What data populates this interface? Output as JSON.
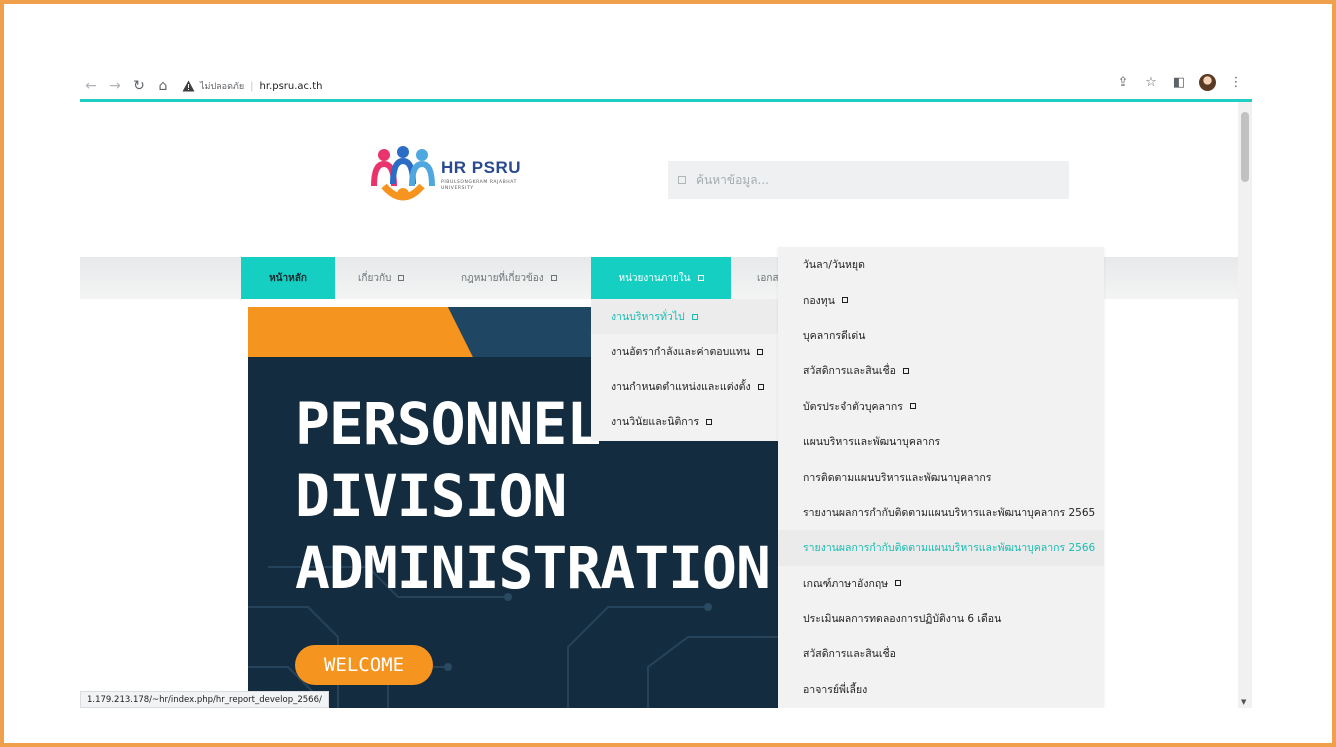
{
  "browser": {
    "security_label": "ไม่ปลอดภัย",
    "url": "hr.psru.ac.th",
    "status_url": "1.179.213.178/~hr/index.php/hr_report_develop_2566/"
  },
  "header": {
    "logo_title": "HR PSRU",
    "logo_subtitle": "PIBULSONGKRAM RAJABHAT UNIVERSITY",
    "search_placeholder": "ค้นหาข้อมูล..."
  },
  "menu": {
    "items": [
      {
        "label": "หน้าหลัก"
      },
      {
        "label": "เกี่ยวกับ"
      },
      {
        "label": "กฎหมายที่เกี่ยวข้อง"
      },
      {
        "label": "หน่วยงานภายใน"
      },
      {
        "label": "เอกส"
      }
    ]
  },
  "submenu": {
    "items": [
      {
        "label": "งานบริหารทั่วไป"
      },
      {
        "label": "งานอัตรากำลังและค่าตอบแทน"
      },
      {
        "label": "งานกำหนดตำแหน่งและแต่งตั้ง"
      },
      {
        "label": "งานวินัยและนิติการ"
      }
    ]
  },
  "subsubmenu": {
    "items": [
      {
        "label": "วันลา/วันหยุด"
      },
      {
        "label": "กองทุน"
      },
      {
        "label": "บุคลากรดีเด่น"
      },
      {
        "label": "สวัสดิการและสินเชื่อ"
      },
      {
        "label": "บัตรประจำตัวบุคลากร"
      },
      {
        "label": "แผนบริหารและพัฒนาบุคลากร"
      },
      {
        "label": "การติดตามแผนบริหารและพัฒนาบุคลากร"
      },
      {
        "label": "รายงานผลการกำกับติดตามแผนบริหารและพัฒนาบุคลากร 2565"
      },
      {
        "label": "รายงานผลการกำกับติดตามแผนบริหารและพัฒนาบุคลากร 2566"
      },
      {
        "label": "เกณฑ์ภาษาอังกฤษ"
      },
      {
        "label": "ประเมินผลการทดลองการปฏิบัติงาน 6 เดือน"
      },
      {
        "label": "สวัสดิการและสินเชื่อ"
      },
      {
        "label": "อาจารย์พี่เลี้ยง"
      }
    ]
  },
  "hero": {
    "line1": "PERSONNEL",
    "line2": "DIVISION",
    "line3": "ADMINISTRATION",
    "button": "WELCOME"
  },
  "colors": {
    "accent": "#15cfc2",
    "orange": "#f5941f",
    "frame": "#f0a04b",
    "hero_bg": "#142c3f"
  }
}
